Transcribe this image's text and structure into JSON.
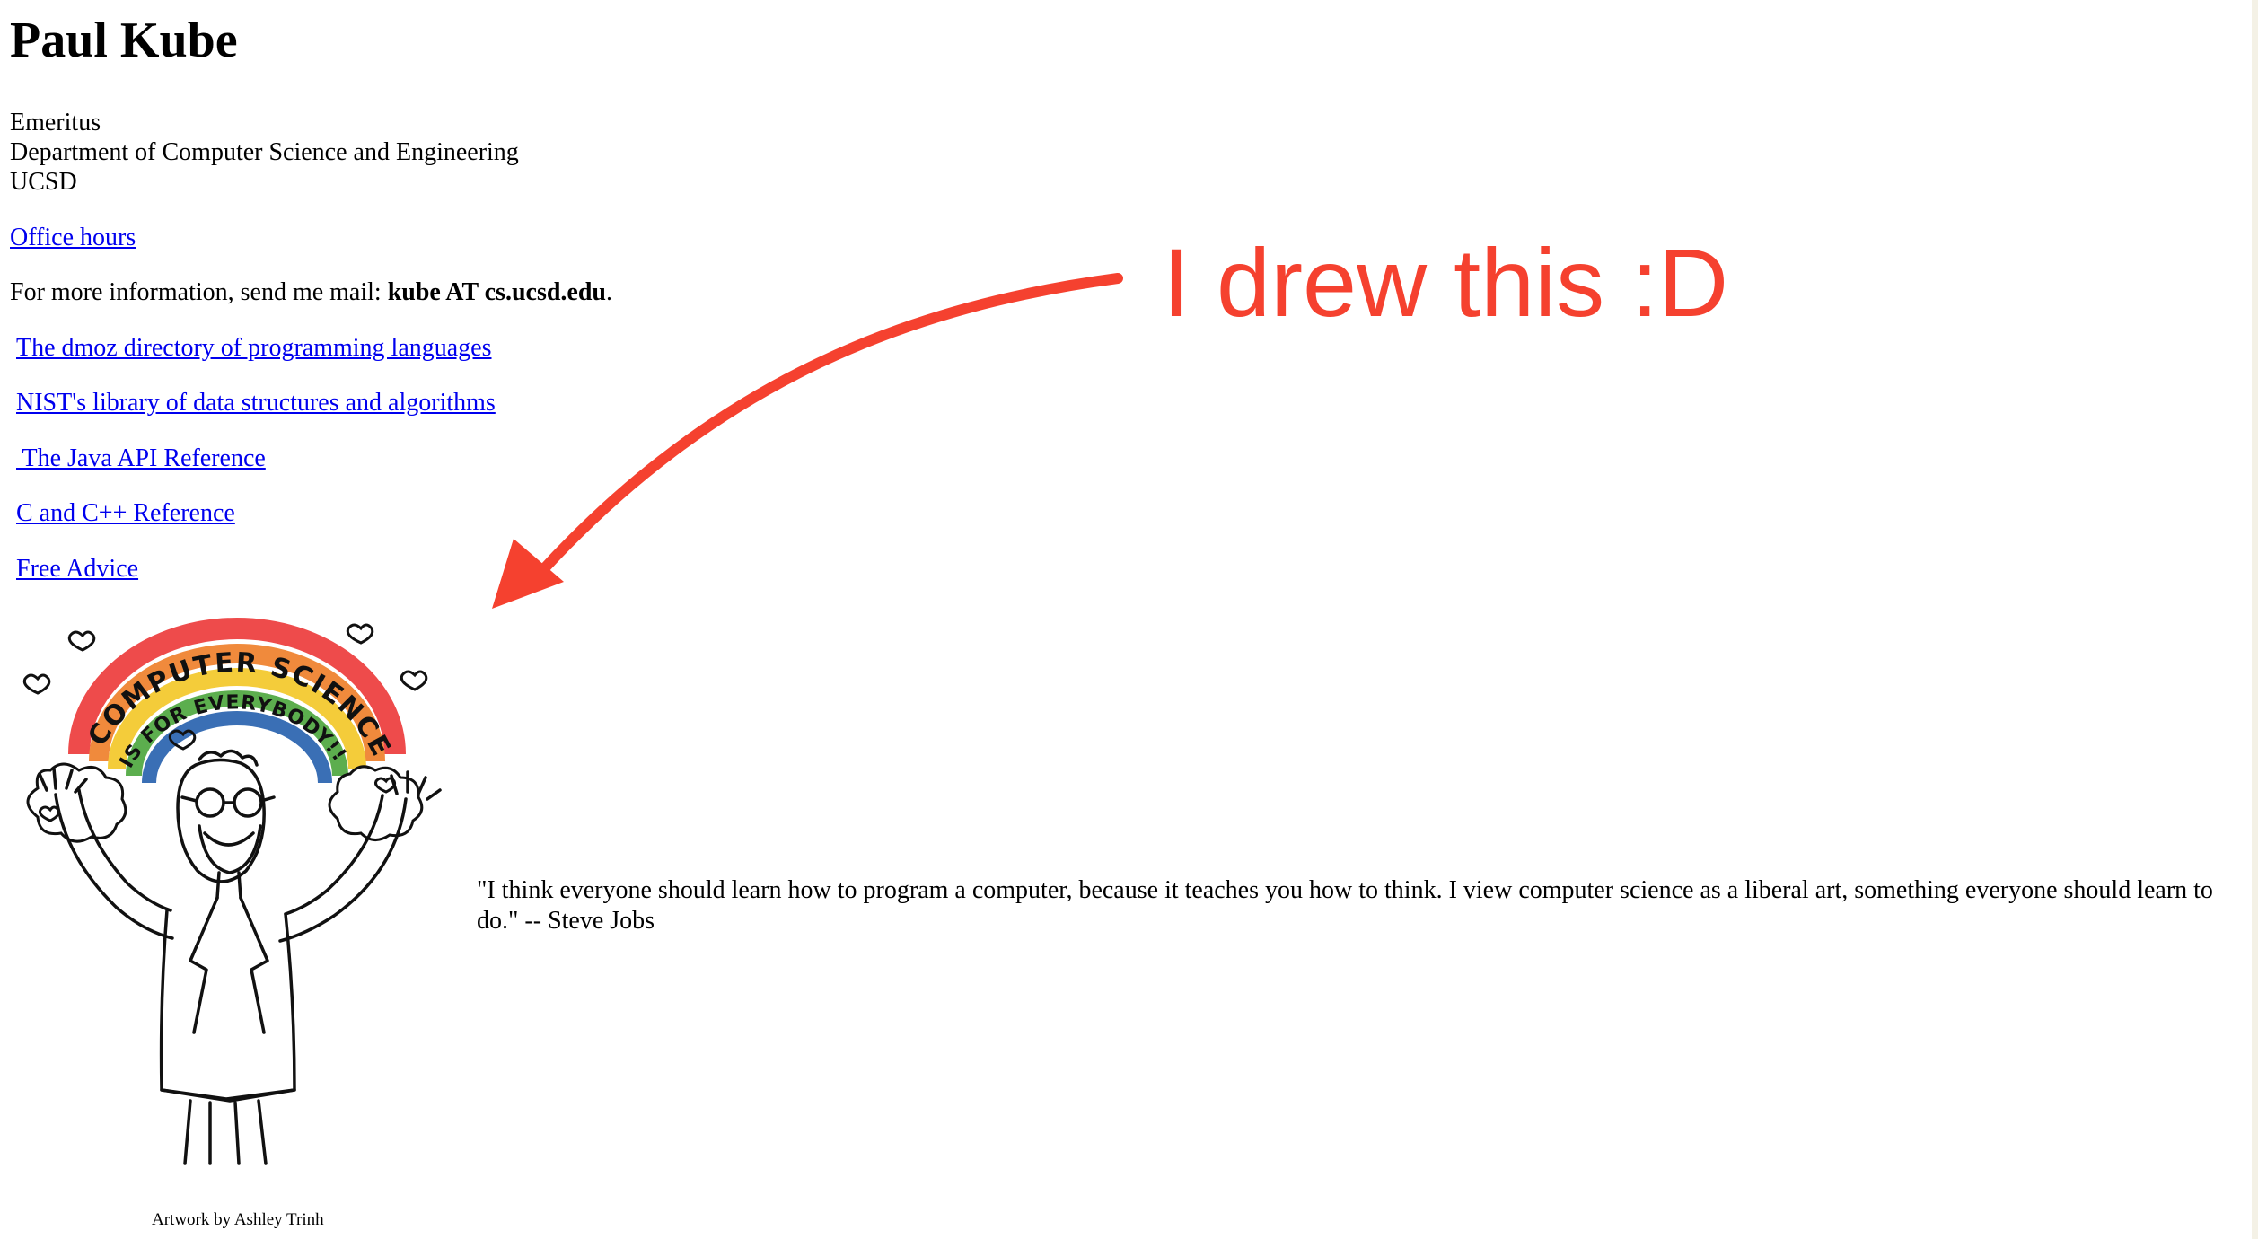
{
  "page": {
    "title": "Paul Kube",
    "role": "Emeritus",
    "department": "Department of Computer Science and Engineering",
    "institution": "UCSD"
  },
  "links": {
    "office_hours": "Office hours",
    "dmoz": "The dmoz directory of programming languages",
    "nist": "NIST's library of data structures and algorithms",
    "java_api": " The Java API Reference",
    "cpp": "C and C++ Reference",
    "free_advice": "Free Advice"
  },
  "contact": {
    "prefix": "For more information, send me mail: ",
    "email": "kube AT cs.ucsd.edu",
    "suffix": "."
  },
  "drawing": {
    "banner_line1": "COMPUTER SCIENCE",
    "banner_line2": "IS FOR EVERYBODY!!"
  },
  "quote": "\"I think everyone should learn how to program a computer, because it teaches you how to think. I view computer science as a liberal art, something everyone should learn to do.\" -- Steve Jobs",
  "credit": "Artwork by Ashley Trinh",
  "annotation": {
    "text": "I drew this :D",
    "color": "#f5412f"
  },
  "colors": {
    "link": "#0000ee",
    "rainbow": [
      "#ee4b4b",
      "#f08a3c",
      "#f4cc3a",
      "#5cae4e",
      "#3a6fb5"
    ]
  }
}
